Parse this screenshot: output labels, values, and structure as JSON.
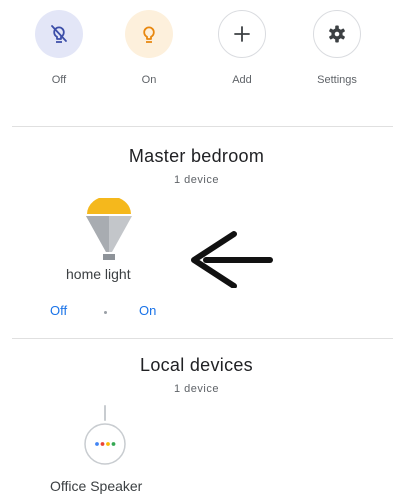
{
  "quick_actions": [
    {
      "label": "Off",
      "icon": "bulb-off-icon",
      "color": "#3c4ea8"
    },
    {
      "label": "On",
      "icon": "bulb-on-icon",
      "color": "#e8870e"
    },
    {
      "label": "Add",
      "icon": "plus-icon",
      "color": "#3c4043"
    },
    {
      "label": "Settings",
      "icon": "gear-icon",
      "color": "#3c4043"
    }
  ],
  "rooms": [
    {
      "title": "Master bedroom",
      "count": "1 device",
      "device": {
        "name": "home light",
        "icon": "light-bulb-icon",
        "controls": {
          "off_label": "Off",
          "on_label": "On"
        }
      }
    },
    {
      "title": "Local devices",
      "count": "1 device",
      "device": {
        "name": "Office Speaker",
        "icon": "smart-speaker-icon"
      }
    }
  ],
  "colors": {
    "accent": "#1a73e8",
    "bulb_yellow": "#f5b81c",
    "bulb_gray": "#9aa0a6"
  }
}
